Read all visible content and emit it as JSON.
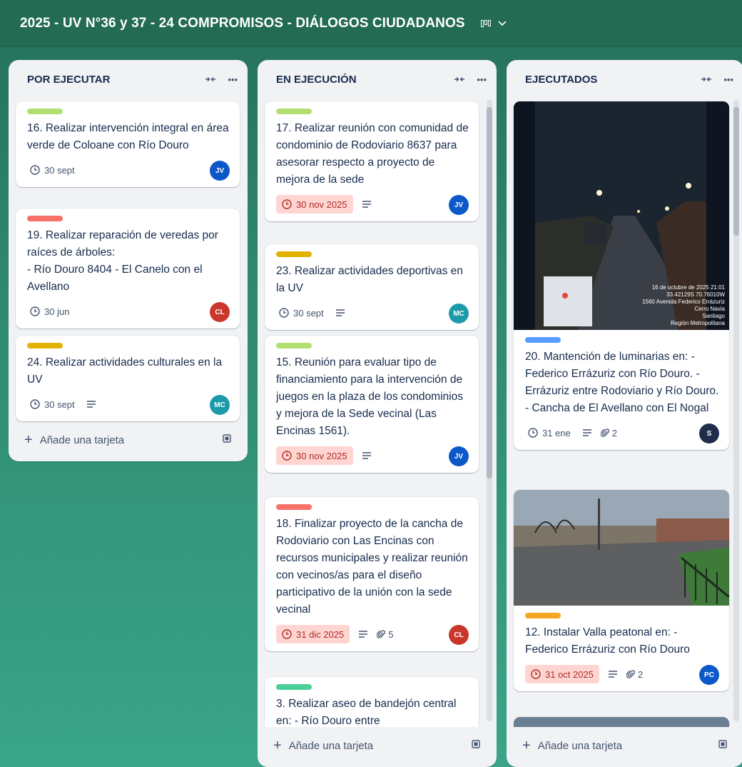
{
  "board": {
    "title": "2025 - UV N°36 y 37 - 24 COMPROMISOS - DIÁLOGOS CIUDADANOS",
    "view_icon": "board-view-icon"
  },
  "lists": [
    {
      "title": "POR EJECUTAR",
      "add_label": "Añade una tarjeta",
      "cards": [
        {
          "label_color": "#b3df72",
          "title": "16. Realizar intervención integral en área verde de Coloane con Río Douro",
          "date": "30 sept",
          "overdue": false,
          "description": false,
          "avatar": "JV",
          "avatar_color": "#0c58c9"
        },
        {
          "label_color": "#f87168",
          "title": "19. Realizar reparación de veredas por raíces de árboles:\n- Río Douro 8404 - El Canelo con el Avellano",
          "date": "30 jun",
          "overdue": false,
          "description": false,
          "avatar": "CL",
          "avatar_color": "#c9372c"
        },
        {
          "label_color": "#e2b203",
          "title": "24. Realizar actividades culturales en la UV",
          "date": "30 sept",
          "overdue": false,
          "description": true,
          "avatar": "MC",
          "avatar_color": "#1d9aaa"
        }
      ]
    },
    {
      "title": "EN EJECUCIÓN",
      "add_label": "Añade una tarjeta",
      "cards": [
        {
          "label_color": "#b3df72",
          "title": "17. Realizar reunión con comunidad de condominio de Rodoviario 8637 para asesorar respecto a proyecto de mejora de la sede",
          "date": "30 nov 2025",
          "overdue": true,
          "description": true,
          "avatar": "JV",
          "avatar_color": "#0c58c9"
        },
        {
          "label_color": "#e2b203",
          "title": "23. Realizar actividades deportivas en la UV",
          "date": "30 sept",
          "overdue": false,
          "description": true,
          "avatar": "MC",
          "avatar_color": "#1d9aaa"
        },
        {
          "label_color": "#b3df72",
          "title": "15. Reunión para evaluar tipo de financiamiento para la intervención de juegos en la plaza de los condominios y mejora de la Sede vecinal (Las Encinas 1561).",
          "date": "30 nov 2025",
          "overdue": true,
          "description": true,
          "avatar": "JV",
          "avatar_color": "#0c58c9"
        },
        {
          "label_color": "#f87168",
          "title": "18. Finalizar proyecto de la cancha de Rodoviario con Las Encinas con recursos municipales y realizar reunión con vecinos/as para el diseño participativo de la unión con la sede vecinal",
          "date": "31 dic 2025",
          "overdue": true,
          "description": true,
          "attachments": "5",
          "avatar": "CL",
          "avatar_color": "#c9372c"
        },
        {
          "label_color": "#4bce97",
          "title": "3. Realizar aseo de bandejón central en: - Río Douro entre"
        }
      ]
    },
    {
      "title": "EJECUTADOS",
      "add_label": "Añade una tarjeta",
      "cards": [
        {
          "cover": "night-street-photo",
          "cover_caption": [
            "16 de octubre de 2025 21:01",
            "33.42129S 70.76010W",
            "1560 Avenida Federico Errázuriz",
            "Cerro Navia",
            "Santiago",
            "Región Metropolitana"
          ],
          "label_color": "#579dff",
          "title": "20. Mantención de luminarias en: - Federico Errázuriz con Río Douro. - Errázuriz entre Rodoviario y Río Douro. - Cancha de El Avellano con El Nogal",
          "date": "31 ene",
          "overdue": false,
          "description": true,
          "attachments": "2",
          "avatar": "S",
          "avatar_color": "#1f2c4a"
        },
        {
          "cover": "street-fence-photo",
          "label_color": "#f5a623",
          "title": "12. Instalar Valla peatonal en: - Federico Errázuriz con Río Douro",
          "date": "31 oct 2025",
          "overdue": true,
          "description": true,
          "attachments": "2",
          "avatar": "PC",
          "avatar_color": "#0c58c9"
        }
      ]
    }
  ]
}
